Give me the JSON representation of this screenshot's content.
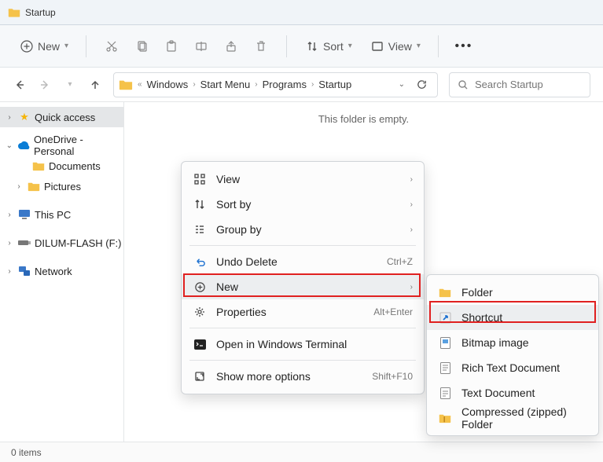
{
  "window": {
    "title": "Startup"
  },
  "toolbar": {
    "new_label": "New",
    "sort_label": "Sort",
    "view_label": "View"
  },
  "breadcrumb": {
    "items": [
      "Windows",
      "Start Menu",
      "Programs",
      "Startup"
    ]
  },
  "search": {
    "placeholder": "Search Startup"
  },
  "sidebar": {
    "quick_access": "Quick access",
    "onedrive": "OneDrive - Personal",
    "documents": "Documents",
    "pictures": "Pictures",
    "this_pc": "This PC",
    "drive": "DILUM-FLASH (F:)",
    "network": "Network"
  },
  "content": {
    "empty": "This folder is empty."
  },
  "status": {
    "items": "0 items"
  },
  "ctx1": {
    "view": "View",
    "sort_by": "Sort by",
    "group_by": "Group by",
    "undo_delete": "Undo Delete",
    "undo_shortcut": "Ctrl+Z",
    "new": "New",
    "properties": "Properties",
    "properties_shortcut": "Alt+Enter",
    "terminal": "Open in Windows Terminal",
    "more": "Show more options",
    "more_shortcut": "Shift+F10"
  },
  "ctx2": {
    "folder": "Folder",
    "shortcut": "Shortcut",
    "bitmap": "Bitmap image",
    "rtf": "Rich Text Document",
    "txt": "Text Document",
    "zip": "Compressed (zipped) Folder"
  }
}
